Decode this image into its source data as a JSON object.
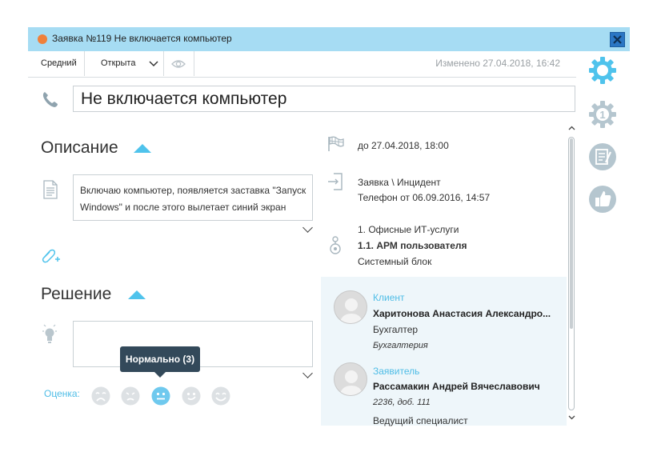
{
  "window": {
    "title": "Заявка №119 Не включается компьютер"
  },
  "toolbar": {
    "priority": "Средний",
    "status": "Открыта",
    "modified": "Изменено 27.04.2018, 16:42"
  },
  "subject": "Не включается компьютер",
  "description": {
    "heading": "Описание",
    "text": "Включаю компьютер, появляется заставка \"Запуск Windows\" и после этого вылетает синий экран"
  },
  "solution": {
    "heading": "Решение",
    "text": ""
  },
  "rating": {
    "label": "Оценка:",
    "tooltip": "Нормально (3)",
    "selected": 3,
    "max": 5
  },
  "info": {
    "deadline": "до 27.04.2018, 18:00",
    "type": "Заявка \\ Инцидент",
    "source": "Телефон от 06.09.2016, 14:57",
    "service_group": "1. Офисные ИТ-услуги",
    "service": "1.1. АРМ пользователя",
    "object": "Системный блок"
  },
  "contacts": [
    {
      "role": "Клиент",
      "name": "Харитонова Анастасия Александро...",
      "line1": "Бухгалтер",
      "line2": "Бухгалтерия"
    },
    {
      "role": "Заявитель",
      "name": "Рассамакин Андрей Вячеславович",
      "line1": "2236, доб. 111",
      "line2": "Ведущий специалист"
    }
  ],
  "colors": {
    "title_bar": "#a6dcf3",
    "accent": "#4fc3ec",
    "status_dot": "#f0803a",
    "close_button": "#2a76c4",
    "tooltip": "#33495a",
    "sidebar_icon": "#b5c6cf"
  },
  "sidebar": {
    "tasks_badge": "1",
    "icons": [
      "settings-gear-icon",
      "tasks-gear-icon",
      "notes-icon",
      "thumbs-up-icon"
    ]
  }
}
